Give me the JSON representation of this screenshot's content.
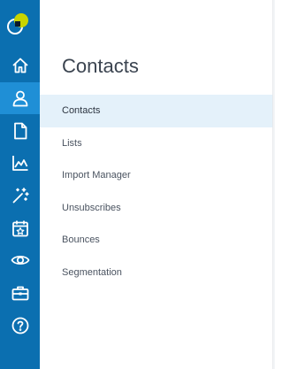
{
  "panel": {
    "title": "Contacts",
    "items": [
      {
        "label": "Contacts",
        "active": true
      },
      {
        "label": "Lists",
        "active": false
      },
      {
        "label": "Import Manager",
        "active": false
      },
      {
        "label": "Unsubscribes",
        "active": false
      },
      {
        "label": "Bounces",
        "active": false
      },
      {
        "label": "Segmentation",
        "active": false
      }
    ]
  },
  "rail": {
    "logo_icon": "brand-logo-icon",
    "items": [
      {
        "icon": "home-icon",
        "active": false
      },
      {
        "icon": "contacts-icon",
        "active": true
      },
      {
        "icon": "document-icon",
        "active": false
      },
      {
        "icon": "reports-chart-icon",
        "active": false
      },
      {
        "icon": "magic-wand-icon",
        "active": false
      },
      {
        "icon": "calendar-star-icon",
        "active": false
      },
      {
        "icon": "eye-icon",
        "active": false
      },
      {
        "icon": "toolbox-icon",
        "active": false
      },
      {
        "icon": "help-icon",
        "active": false
      }
    ]
  },
  "colors": {
    "rail": "#0b6fb0",
    "rail_active": "#1f8fd6",
    "menu_active": "#e4f1fa",
    "logo_accent": "#c8d400"
  }
}
